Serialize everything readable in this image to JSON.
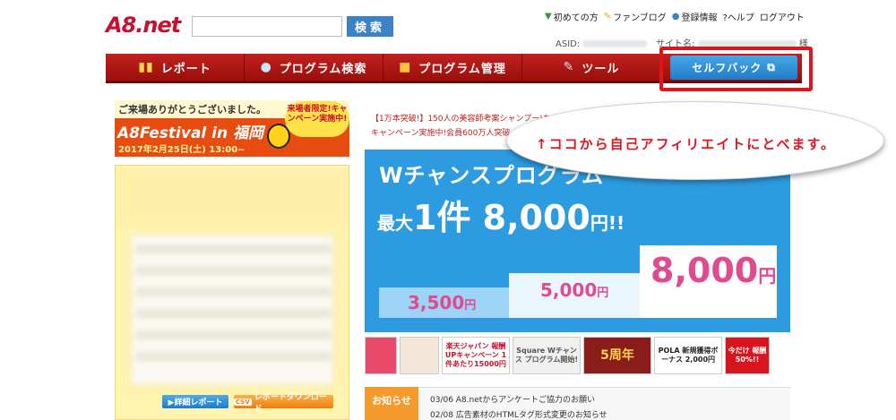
{
  "header": {
    "logo": "A8.net",
    "search_button": "検索",
    "links": [
      {
        "icon": "beginner-icon",
        "label": "初めての方"
      },
      {
        "icon": "pencil-icon",
        "label": "ファンブログ"
      },
      {
        "icon": "user-icon",
        "label": "登録情報"
      },
      {
        "icon": "help-icon",
        "label": "?ヘルプ"
      },
      {
        "icon": "",
        "label": "ログアウト"
      }
    ],
    "asid_label": "ASID:",
    "site_label": "サイト名:",
    "suffix": "様"
  },
  "nav": {
    "items": [
      {
        "label": "レポート",
        "icon": "bar-chart-icon"
      },
      {
        "label": "プログラム検索",
        "icon": "search-icon"
      },
      {
        "label": "プログラム管理",
        "icon": "folder-icon"
      },
      {
        "label": "ツール",
        "icon": "wrench-icon"
      }
    ],
    "selfback": "セルフバック",
    "selfback_icon": "window-icon"
  },
  "festival": {
    "greeting": "ご来場ありがとうございました。",
    "title": "A8Festival in 福岡",
    "date": "2017年2月25日(土) 13:00~",
    "badge": "来場者限定!キャンペーン実施中!"
  },
  "left": {
    "detail_button": "▶詳細レポート",
    "csv": "CSV",
    "download_button": "レポートダウンロード"
  },
  "notice_top": [
    "【1万本突破!】150人の美容師考案シャンプー!お試しセット",
    "キャンペーン実施中!会員600万人突破★無料"
  ],
  "bubble": "↑ココから自己アフィリエイトにとべます。",
  "wchance": {
    "title": "Wチャンスプログラム",
    "max_prefix": "最大",
    "max_big": "1件 8,000",
    "max_unit": "円!!",
    "bars": [
      {
        "value": "3,500",
        "unit": "円"
      },
      {
        "value": "5,000",
        "unit": "円"
      },
      {
        "value": "8,000",
        "unit": "円"
      }
    ]
  },
  "thumbs": [
    {
      "text": "",
      "color": "#e84a6a"
    },
    {
      "text": "",
      "color": "#f4e6d8"
    },
    {
      "text": "楽天ジャパン 報酬UPキャンペーン 1件あたり15000円",
      "color": "#ffffff"
    },
    {
      "text": "Square Wチャンス プログラム開始!",
      "color": "#f0f0f0"
    },
    {
      "text": "5周年",
      "color": "#8a1c1c"
    },
    {
      "text": "POLA 新規獲得ボーナス 2,000円",
      "color": "#ffffff"
    },
    {
      "text": "今だけ 報酬 50%!!",
      "color": "#d8141e"
    }
  ],
  "news": {
    "label": "お知らせ",
    "items": [
      "03/06 A8.netからアンケートご協力のお願い",
      "02/08 広告素材のHTMLタグ形式変更のお知らせ"
    ]
  }
}
